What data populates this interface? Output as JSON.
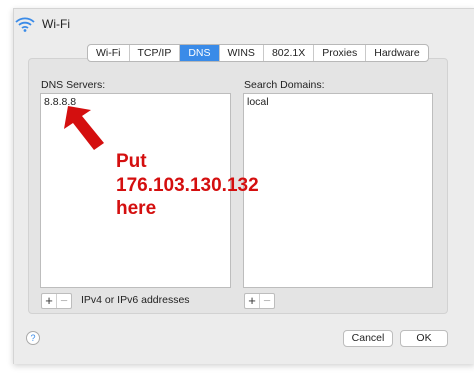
{
  "window": {
    "title": "Wi-Fi",
    "wifi_icon": "wifi-icon"
  },
  "tabs": [
    {
      "label": "Wi-Fi",
      "active": false
    },
    {
      "label": "TCP/IP",
      "active": false
    },
    {
      "label": "DNS",
      "active": true
    },
    {
      "label": "WINS",
      "active": false
    },
    {
      "label": "802.1X",
      "active": false
    },
    {
      "label": "Proxies",
      "active": false
    },
    {
      "label": "Hardware",
      "active": false
    }
  ],
  "dns": {
    "label": "DNS Servers:",
    "servers": [
      "8.8.8.8"
    ],
    "hint": "IPv4 or IPv6 addresses"
  },
  "search": {
    "label": "Search Domains:",
    "domains": [
      "local"
    ]
  },
  "controls": {
    "add": "+",
    "remove": "−"
  },
  "annotation": {
    "line1": "Put",
    "line2": "176.103.130.132",
    "line3": "here",
    "color": "#d40f0f"
  },
  "buttons": {
    "help": "?",
    "cancel": "Cancel",
    "ok": "OK"
  },
  "colors": {
    "accent": "#3a8be8"
  }
}
